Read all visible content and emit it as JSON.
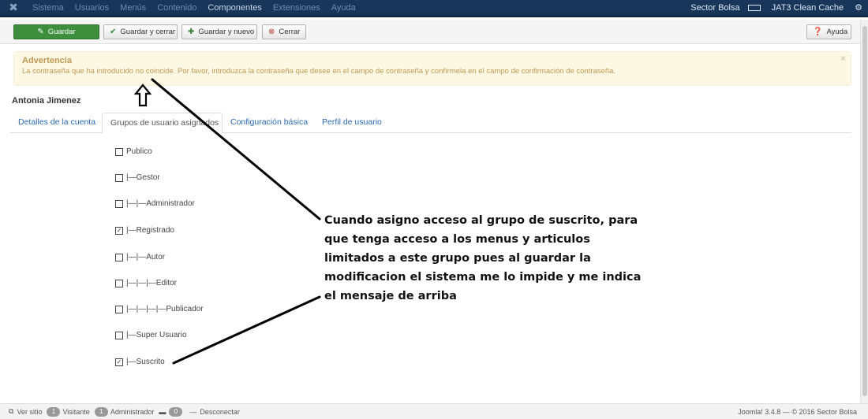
{
  "navbar": {
    "menu": [
      "Sistema",
      "Usuarios",
      "Menús",
      "Contenido",
      "Componentes",
      "Extensiones",
      "Ayuda"
    ],
    "site": "Sector Bolsa",
    "cache": "JAT3 Clean Cache"
  },
  "toolbar": {
    "save": "Guardar",
    "save_close": "Guardar y cerrar",
    "save_new": "Guardar y nuevo",
    "close": "Cerrar",
    "help": "Ayuda"
  },
  "alert": {
    "heading": "Advertencia",
    "message": "La contraseña que ha introducido no coincide. Por favor, introduzca la contraseña que desee en el campo de contraseña y confírmela en el campo de confirmación de contraseña."
  },
  "user": {
    "name": "Antonia Jimenez"
  },
  "tabs": [
    {
      "label": "Detalles de la cuenta"
    },
    {
      "label": "Grupos de usuario asignados"
    },
    {
      "label": "Configuración básica"
    },
    {
      "label": "Perfil de usuario"
    }
  ],
  "groups": [
    {
      "label": "Publico",
      "checked": false
    },
    {
      "label": "|—Gestor",
      "checked": false
    },
    {
      "label": "|—|—Administrador",
      "checked": false
    },
    {
      "label": "|—Registrado",
      "checked": true
    },
    {
      "label": "|—|—Autor",
      "checked": false
    },
    {
      "label": "|—|—|—Editor",
      "checked": false
    },
    {
      "label": "|—|—|—|—Publicador",
      "checked": false
    },
    {
      "label": "|—Super Usuario",
      "checked": false
    },
    {
      "label": "|—Suscrito",
      "checked": true
    }
  ],
  "annotation": {
    "text": "Cuando asigno acceso al grupo de suscrito, para que tenga acceso a los menus y articulos limitados a este grupo  pues al guardar la modificacion el sistema me lo impide y me indica el mensaje de arriba"
  },
  "statusbar": {
    "view_site": "Ver sitio",
    "visitors_count": "1",
    "visitors": "Visitante",
    "admins_count": "1",
    "admins": "Administrador",
    "messages_count": "0",
    "logout": "Desconectar",
    "version": "Joomla! 3.4.8 — © 2016 Sector Bolsa"
  }
}
